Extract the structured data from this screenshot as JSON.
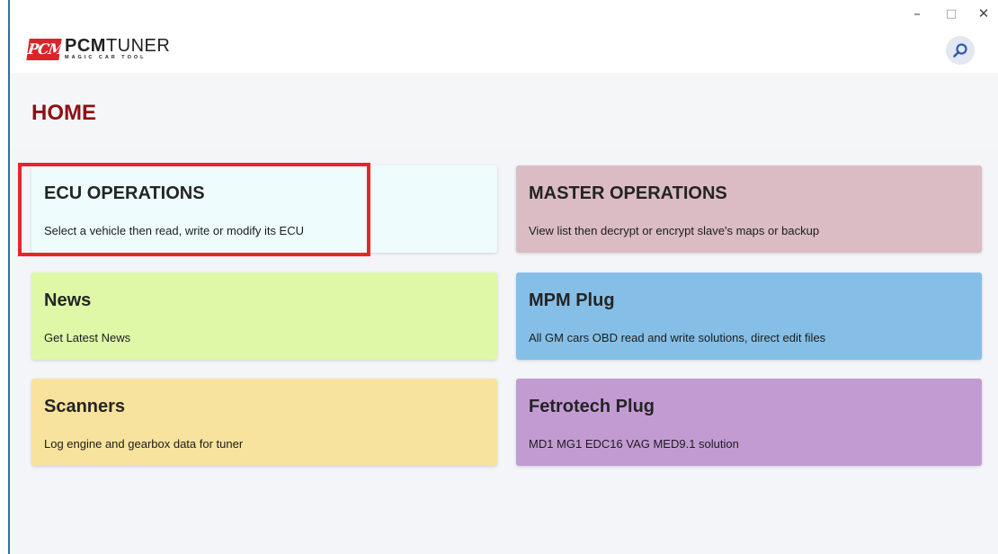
{
  "window": {
    "controls": {
      "minimize": "–",
      "maximize": "□",
      "close": "✕"
    }
  },
  "header": {
    "logo": {
      "badge": "PCM",
      "name_bold": "PCM",
      "name_rest": "TUNER",
      "tagline": "MAGIC CAR TOOL"
    },
    "search_icon": "search-icon"
  },
  "page": {
    "title": "HOME"
  },
  "tiles": [
    {
      "title": "ECU OPERATIONS",
      "description": "Select a vehicle then read, write or modify its ECU",
      "color": "#eefcfd"
    },
    {
      "title": "MASTER OPERATIONS",
      "description": "View list then decrypt or encrypt slave's maps or backup",
      "color": "#dbbcc4"
    },
    {
      "title": "News",
      "description": "Get Latest News",
      "color": "#def8a8"
    },
    {
      "title": "MPM Plug",
      "description": "All GM cars OBD read and write solutions, direct edit files",
      "color": "#85bfe7"
    },
    {
      "title": "Scanners",
      "description": "Log engine and gearbox data for tuner",
      "color": "#f7e39d"
    },
    {
      "title": "Fetrotech Plug",
      "description": "MD1 MG1 EDC16 VAG MED9.1 solution",
      "color": "#c39bd3"
    }
  ],
  "highlight_color": "#e6262b",
  "brand_color": "#8e1015"
}
